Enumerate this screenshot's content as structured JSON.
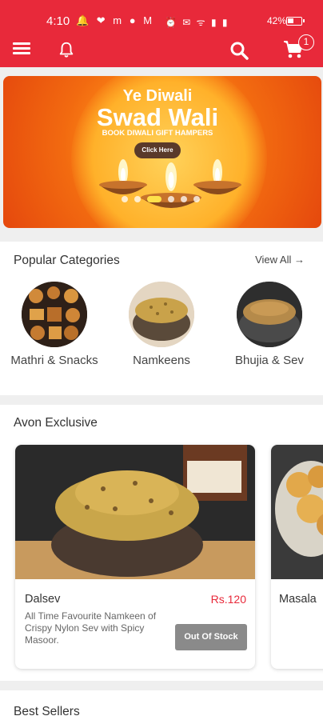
{
  "status_bar": {
    "time": "4:10",
    "left_icons": "🔔 ❤ m ● M",
    "right_icons": "⏰ ✉ ᯤ ▮ ▮",
    "battery": "42%"
  },
  "header": {
    "cart_count": "1",
    "icons": [
      "menu-icon",
      "bell-icon",
      "search-icon",
      "cart-icon"
    ]
  },
  "banner": {
    "line1": "Ye Diwali",
    "line2": "Swad Wali",
    "line3": "BOOK DIWALI GIFT HAMPERS",
    "cta": "Click Here",
    "slide_count": 6,
    "active_slide": 2
  },
  "popular": {
    "title": "Popular Categories",
    "view_all": "View All →",
    "categories": [
      {
        "label": "Mathri & Snacks"
      },
      {
        "label": "Namkeens"
      },
      {
        "label": "Bhujia & Sev"
      }
    ]
  },
  "exclusive": {
    "title": "Avon Exclusive",
    "products": [
      {
        "name": "Dalsev",
        "price": "Rs.120",
        "description": "All Time Favourite Namkeen of Crispy Nylon Sev with Spicy Masoor.",
        "button": "Out Of Stock"
      },
      {
        "name": "Masala"
      }
    ]
  },
  "bestsellers": {
    "title": "Best Sellers"
  },
  "colors": {
    "brand_red": "#e8293a",
    "price_red": "#e8293a",
    "out_of_stock_grey": "#8a8a8a"
  }
}
